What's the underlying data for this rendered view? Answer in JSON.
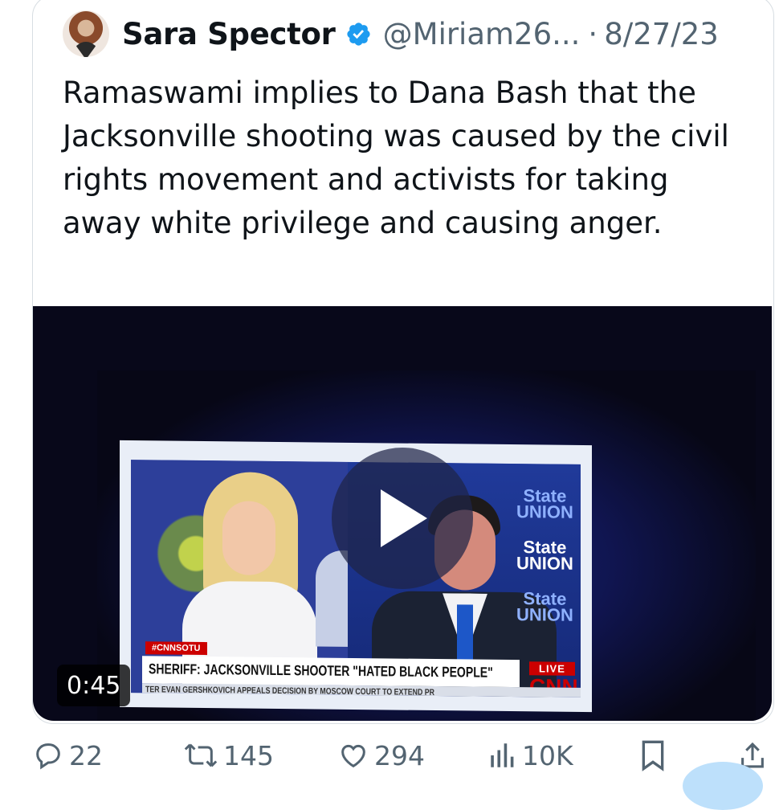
{
  "tweet": {
    "author_name": "Sara Spector",
    "handle": "@Miriam26...",
    "separator": "·",
    "date": "8/27/23",
    "text": "Ramaswami implies to Dana Bash that the Jacksonville shooting was caused by the civil rights movement and activists for taking away white privilege and causing anger."
  },
  "video": {
    "duration": "0:45",
    "hashtag": "#CNNSOTU",
    "chyron": "SHERIFF: JACKSONVILLE SHOOTER \"HATED BLACK PEOPLE\"",
    "live_badge": "LIVE",
    "network": "CNN",
    "ticker": "TER EVAN GERSHKOVICH APPEALS DECISION BY MOSCOW COURT TO EXTEND PR",
    "brand_lines": [
      "State",
      "UNION"
    ]
  },
  "actions": {
    "replies": "22",
    "retweets": "145",
    "likes": "294",
    "views": "10K"
  },
  "colors": {
    "verified": "#1d9bf0",
    "text_secondary": "#536471",
    "cnn_red": "#cc0000"
  },
  "icons": [
    "verified-badge-icon",
    "play-icon",
    "reply-icon",
    "retweet-icon",
    "like-icon",
    "views-icon",
    "bookmark-icon",
    "share-icon"
  ]
}
